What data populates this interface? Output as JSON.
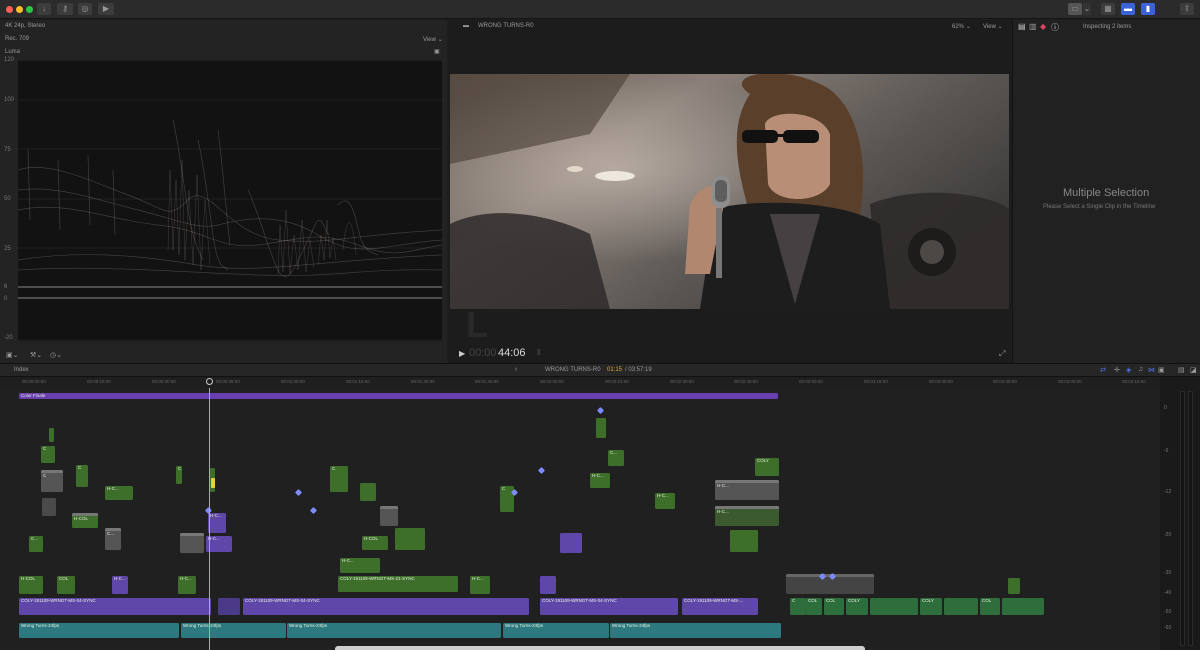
{
  "scope": {
    "project_format": "4K 24p, Stereo",
    "color_space": "Rec. 709",
    "view_label": "View",
    "scope_title": "Luma",
    "scale": [
      "120",
      "100",
      "75",
      "50",
      "25",
      "6",
      "0",
      "-20"
    ]
  },
  "viewer": {
    "clip_title": "WRONG TURNS-R0",
    "zoom": "62%",
    "view_label": "View",
    "timecode_dim": "00:00",
    "timecode": "44:06"
  },
  "inspector": {
    "header": "Inspecting 2 items",
    "title": "Multiple Selection",
    "message": "Please Select a Single Clip in the Timeline"
  },
  "timeline": {
    "index_label": "Index",
    "project_name": "WRONG TURNS-R0",
    "position": "01:15",
    "duration": "/ 03:57:19",
    "ruler": [
      "00:00:00:00",
      "00:00:15:00",
      "00:00:30:00",
      "00:00:45:00",
      "00:01:00:00",
      "00:01:15:00",
      "00:01:30:00",
      "00:01:45:00",
      "00:02:00:00",
      "00:02:15:00",
      "00:02:30:00",
      "00:02:45:00",
      "00:03:00:00",
      "00:03:15:00",
      "00:03:30:00",
      "00:03:45:00",
      "00:04:00:00",
      "00:04:15:00"
    ],
    "adjustment_clip": "Color Finale",
    "primary_clip_a": "COLY-191109-WRNGT-MS-04-SYNC",
    "primary_clip_b": "COLY-191109-WRNGT-MS-04-SYNC",
    "primary_clip_c": "COLY-191109-WRNGT-MS-04-SYNC",
    "primary_clip_d": "COLY-191109-WRNGT-MS-...",
    "mid_clip_a": "COLY-191109-WRNGT-MS-21-SYNC",
    "mid_clip_b": "COLY-191109-WRNGT-MS-21-SYNC",
    "audio_a": "Wrong Turns-24fps",
    "audio_b": "Wrong Turns-24fps",
    "audio_c": "Wrong Turns-24fps",
    "audio_d": "Wrong Turns-24fps",
    "audio_e": "Wrong Turns-24fps",
    "short_c": "C",
    "short_col": "COL",
    "short_coly": "COLY",
    "short_cl": "C...",
    "short_hcl": "H-C...",
    "short_hcol": "H-COL"
  },
  "meters": {
    "scale": [
      "0",
      "-6",
      "-12",
      "-20",
      "-30",
      "-40",
      "-50",
      "-60"
    ]
  },
  "colors": {
    "accent": "#3b62d8",
    "storyline_purple": "#5e47a8",
    "clip_green": "#3e6f2a",
    "audio_teal": "#2c7a80",
    "adjustment_purple": "#6a3fb0"
  }
}
